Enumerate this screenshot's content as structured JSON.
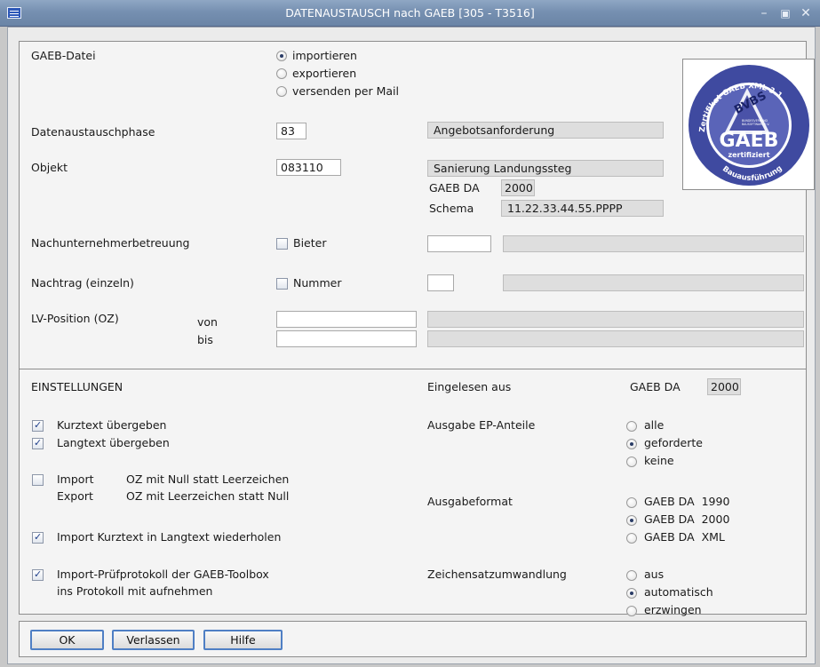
{
  "window": {
    "title": "DATENAUSTAUSCH nach GAEB  [305 - T3516]",
    "icon": "table-icon"
  },
  "gaeb_datei": {
    "label": "GAEB-Datei",
    "options": [
      "importieren",
      "exportieren",
      "versenden per Mail"
    ],
    "selected": "importieren"
  },
  "datenaustauschphase": {
    "label": "Datenaustauschphase",
    "code": "83",
    "description": "Angebotsanforderung"
  },
  "objekt": {
    "label": "Objekt",
    "code": "083110",
    "description": "Sanierung Landungssteg",
    "gaeb_da_label": "GAEB DA",
    "gaeb_da_value": "2000",
    "schema_label": "Schema",
    "schema_value": "11.22.33.44.55.PPPP"
  },
  "nachunternehmer": {
    "label": "Nachunternehmerbetreuung",
    "checkbox_label": "Bieter",
    "checked": false,
    "code": "",
    "description": ""
  },
  "nachtrag": {
    "label": "Nachtrag (einzeln)",
    "checkbox_label": "Nummer",
    "checked": false,
    "code": "",
    "description": ""
  },
  "lv_position": {
    "label": "LV-Position (OZ)",
    "von_label": "von",
    "bis_label": "bis",
    "von_value": "",
    "bis_value": ""
  },
  "badge": {
    "ring_top": "Zertifikat GAEB XML 3.1",
    "brand": "BVBS",
    "brand_sub1": "BUNDESVERBAND",
    "brand_sub2": "BAUSOFTWARE E.V.",
    "gaeb": "GAEB",
    "zertifiziert": "zertifiziert",
    "ring_bottom": "Bauausführung",
    "colors": {
      "ring": "#3f4aa0",
      "inner": "#5a64b8",
      "text": "#ffffff"
    }
  },
  "einstellungen": {
    "title": "EINSTELLUNGEN",
    "eingelesen_label": "Eingelesen aus",
    "eingelesen_gaeb_label": "GAEB DA",
    "eingelesen_gaeb_value": "2000",
    "kurztext": {
      "label": "Kurztext übergeben",
      "checked": true
    },
    "langtext": {
      "label": "Langtext übergeben",
      "checked": true
    },
    "oz_null": {
      "checked": false,
      "import_label": "Import",
      "import_text": "OZ mit Null statt Leerzeichen",
      "export_label": "Export",
      "export_text": "OZ mit Leerzeichen statt Null"
    },
    "kurztext_wiederholen": {
      "label": "Import Kurztext in Langtext wiederholen",
      "checked": true
    },
    "pruefprotokoll": {
      "line1": "Import-Prüfprotokoll der GAEB-Toolbox",
      "line2": "ins Protokoll mit aufnehmen",
      "checked": true
    },
    "ep_anteile": {
      "label": "Ausgabe EP-Anteile",
      "options": [
        "alle",
        "geforderte",
        "keine"
      ],
      "selected": "geforderte"
    },
    "ausgabeformat": {
      "label": "Ausgabeformat",
      "options": [
        "GAEB DA  1990",
        "GAEB DA  2000",
        "GAEB DA  XML"
      ],
      "selected": "GAEB DA  2000"
    },
    "zeichensatz": {
      "label": "Zeichensatzumwandlung",
      "options": [
        "aus",
        "automatisch",
        "erzwingen"
      ],
      "selected": "automatisch"
    }
  },
  "buttons": {
    "ok": "OK",
    "verlassen": "Verlassen",
    "hilfe": "Hilfe"
  }
}
